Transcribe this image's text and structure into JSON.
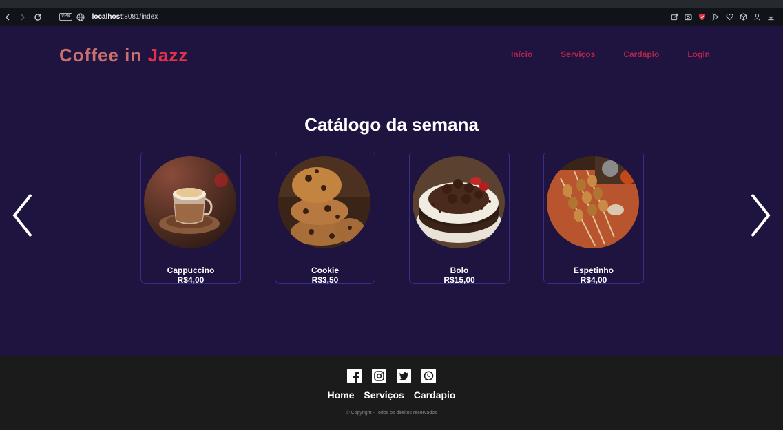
{
  "browser": {
    "vpn_label": "VPN",
    "url_host": "localhost",
    "url_rest": ":8081/index"
  },
  "header": {
    "logo_part1": "Coffee in ",
    "logo_part2": "Jazz",
    "nav": [
      "Início",
      "Serviços",
      "Cardápio",
      "Login"
    ]
  },
  "catalog": {
    "title": "Catálogo da semana",
    "items": [
      {
        "name": "Cappuccino",
        "price": "R$4,00",
        "image": "cappuccino-image"
      },
      {
        "name": "Cookie",
        "price": "R$3,50",
        "image": "cookie-image"
      },
      {
        "name": "Bolo",
        "price": "R$15,00",
        "image": "cake-image"
      },
      {
        "name": "Espetinho",
        "price": "R$4,00",
        "image": "skewer-image"
      }
    ]
  },
  "footer": {
    "social": [
      "facebook-icon",
      "instagram-icon",
      "twitter-icon",
      "whatsapp-icon"
    ],
    "links": [
      "Home",
      "Serviços",
      "Cardapio"
    ],
    "copyright": "© Copyright - Todos os direitos reservados"
  },
  "colors": {
    "page_bg": "#1f1340",
    "logo_part1": "#c9706d",
    "logo_part2": "#e0334b",
    "nav_link": "#b3264c",
    "footer_bg": "#1b1b1b"
  }
}
